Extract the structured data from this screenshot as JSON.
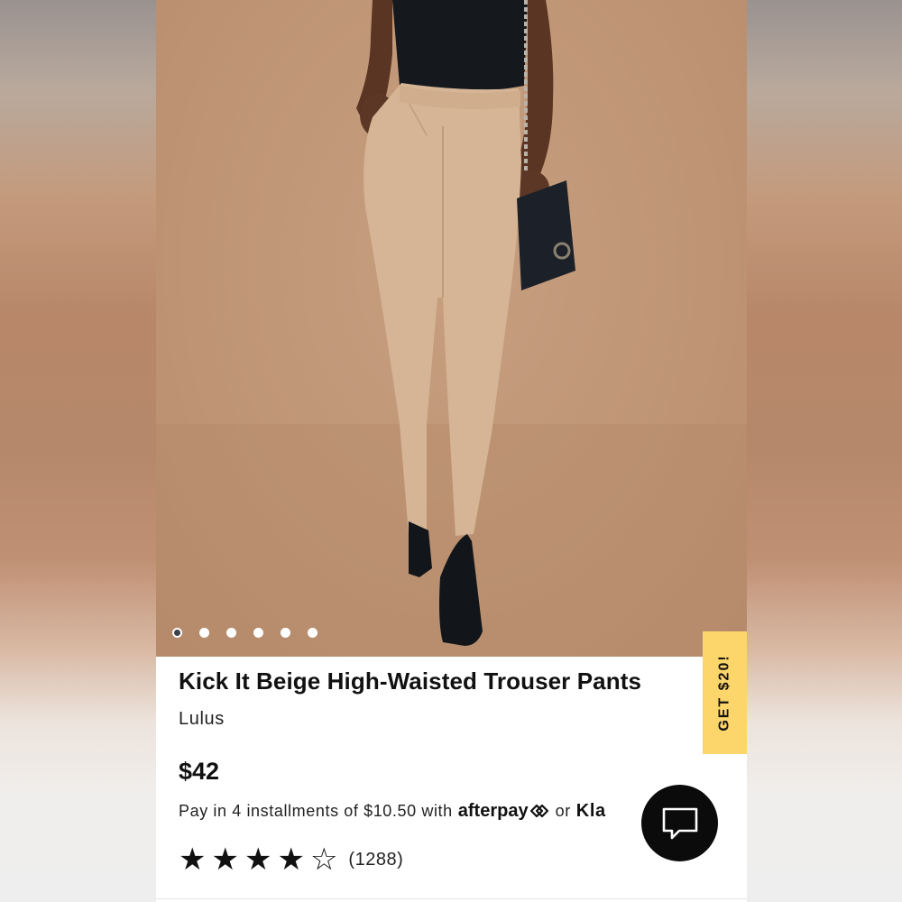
{
  "product": {
    "title": "Kick It Beige High-Waisted Trouser Pants",
    "brand": "Lulus",
    "price": "$42",
    "payment": {
      "prefix": "Pay in 4 installments of $10.50 with",
      "afterpay": "afterpay",
      "or": "or",
      "klarna": "Kla"
    },
    "rating": {
      "stars": 4,
      "max": 5,
      "count_label": "(1288)"
    }
  },
  "gallery": {
    "image_count": 6,
    "active_index": 0
  },
  "promo": {
    "label": "GET $20!"
  },
  "icons": {
    "chat": "chat-bubble-icon",
    "afterpay_logo": "afterpay-loop-icon",
    "star_filled": "star-filled-icon",
    "star_empty": "star-outline-icon"
  },
  "colors": {
    "promo_bg": "#fcd56b",
    "chat_bg": "#0b0b0b",
    "hero_bg": "#c09777"
  }
}
